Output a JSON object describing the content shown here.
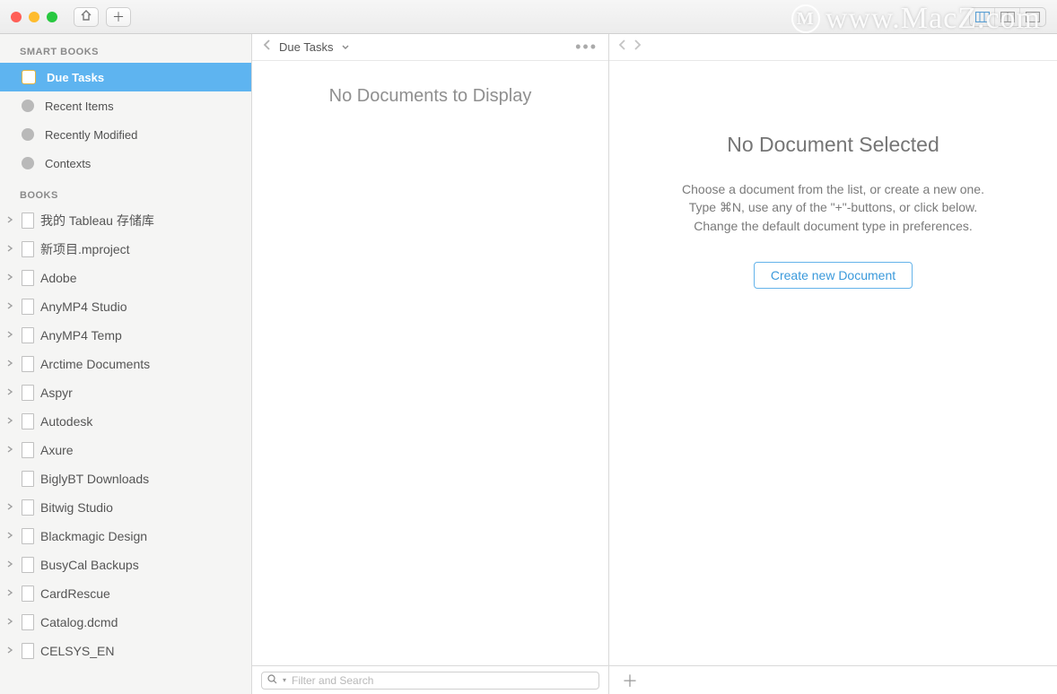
{
  "watermark": "www.MacZ.com",
  "sidebar": {
    "sections": {
      "smart_books": {
        "header": "SMART BOOKS",
        "items": [
          {
            "label": "Due Tasks",
            "icon": "due",
            "selected": true
          },
          {
            "label": "Recent Items",
            "icon": "circle",
            "selected": false
          },
          {
            "label": "Recently Modified",
            "icon": "circle",
            "selected": false
          },
          {
            "label": "Contexts",
            "icon": "circle",
            "selected": false
          }
        ]
      },
      "books": {
        "header": "BOOKS",
        "items": [
          {
            "label": "我的 Tableau 存储库",
            "has_children": true
          },
          {
            "label": "新项目.mproject",
            "has_children": true
          },
          {
            "label": "Adobe",
            "has_children": true
          },
          {
            "label": "AnyMP4 Studio",
            "has_children": true
          },
          {
            "label": "AnyMP4 Temp",
            "has_children": true
          },
          {
            "label": "Arctime Documents",
            "has_children": true
          },
          {
            "label": "Aspyr",
            "has_children": true
          },
          {
            "label": "Autodesk",
            "has_children": true
          },
          {
            "label": "Axure",
            "has_children": true
          },
          {
            "label": "BiglyBT Downloads",
            "has_children": false
          },
          {
            "label": "Bitwig Studio",
            "has_children": true
          },
          {
            "label": "Blackmagic Design",
            "has_children": true
          },
          {
            "label": "BusyCal Backups",
            "has_children": true
          },
          {
            "label": "CardRescue",
            "has_children": true
          },
          {
            "label": "Catalog.dcmd",
            "has_children": true
          },
          {
            "label": "CELSYS_EN",
            "has_children": true
          }
        ]
      }
    }
  },
  "middle": {
    "title": "Due Tasks",
    "empty_message": "No Documents to Display",
    "search_placeholder": "Filter and Search"
  },
  "detail": {
    "title": "No Document Selected",
    "line1": "Choose a document from the list, or create a new one.",
    "line2": "Type ⌘N, use any of the \"+\"-buttons, or click below.",
    "line3": "Change the default document type in preferences.",
    "create_label": "Create new Document"
  }
}
